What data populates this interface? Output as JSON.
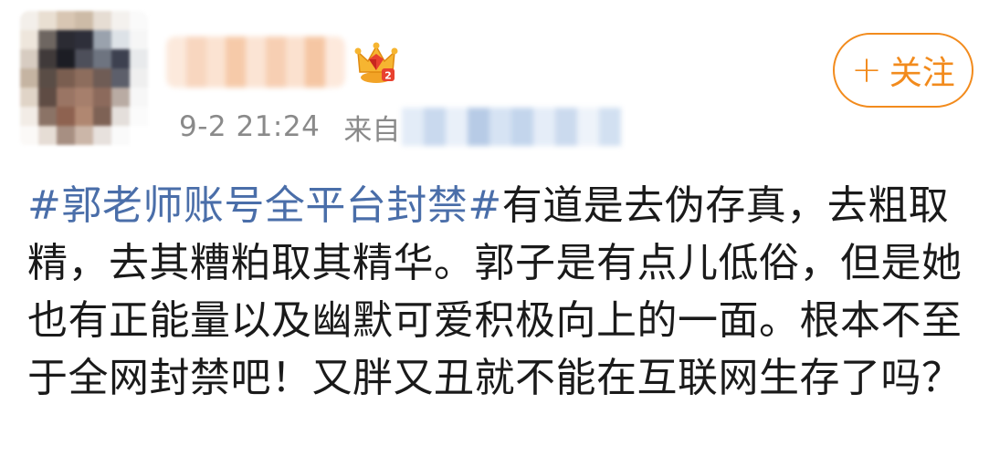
{
  "post": {
    "follow_plus": "+",
    "follow_label": "关注",
    "time": "9-2 21:24",
    "source_prefix": "来自",
    "hashtag": "#郭老师账号全平台封禁#",
    "body_text": "有道是去伪存真，去粗取精，去其糟粕取其精华。郭子是有点儿低俗，但是她也有正能量以及幽默可爱积极向上的一面。根本不至于全网封禁吧！又胖又丑就不能在互联网生存了吗？"
  },
  "icons": {
    "crown": "crown-badge-icon"
  },
  "colors": {
    "accent": "#f28b1d",
    "hashtag": "#4a6ea9",
    "meta_text": "#8a8a8a",
    "body_text": "#1a1a1a"
  }
}
